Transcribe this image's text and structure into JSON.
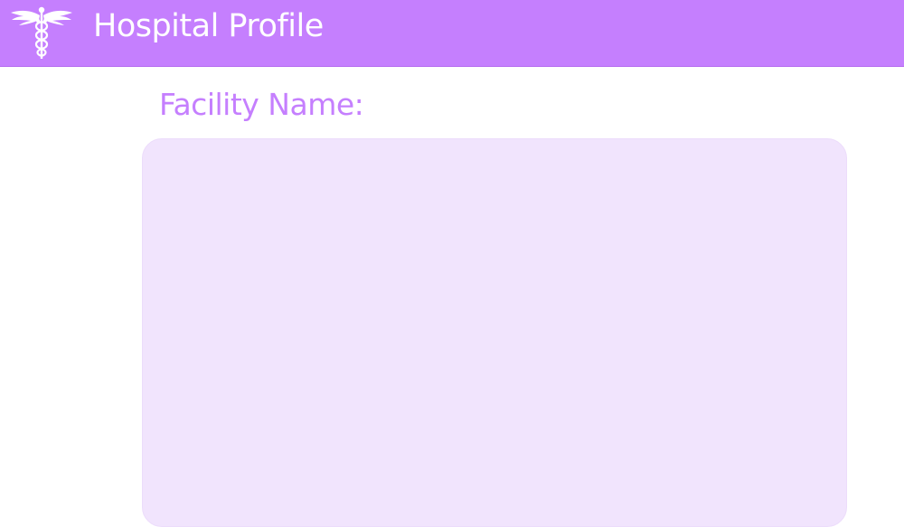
{
  "header": {
    "logo_icon": "caduceus-icon",
    "title": "Hospital Profile",
    "background_color": "#c57ffe"
  },
  "form": {
    "facility_name_label": "Facility Name:",
    "facility_name_value": "",
    "facility_name_placeholder": "",
    "label_color": "#c57ffe",
    "field_background": "#f1e4fd"
  }
}
